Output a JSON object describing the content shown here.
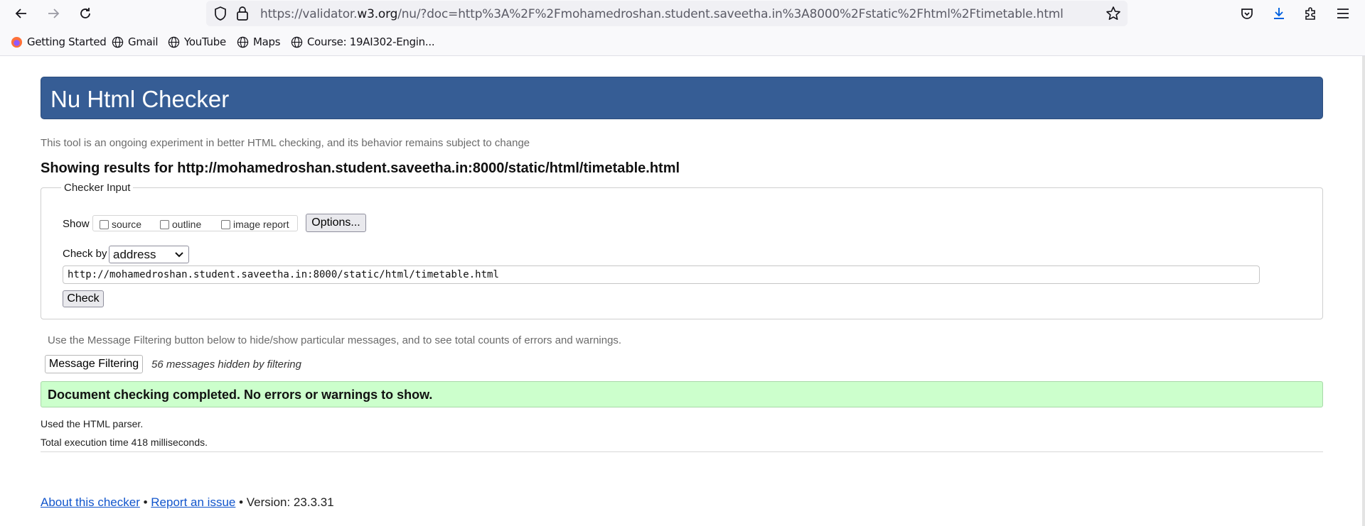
{
  "browser": {
    "url_prefix": "https://validator.",
    "url_host": "w3.org",
    "url_suffix": "/nu/?doc=http%3A%2F%2Fmohamedroshan.student.saveetha.in%3A8000%2Fstatic%2Fhtml%2Ftimetable.html",
    "icons": {
      "back": "arrow-left-icon",
      "forward": "arrow-right-icon",
      "reload": "reload-icon",
      "tracking": "shield-icon",
      "lock": "lock-icon",
      "bookmark_star": "star-icon",
      "pocket": "pocket-icon",
      "downloads": "download-icon",
      "extensions": "puzzle-icon",
      "menu": "hamburger-menu-icon"
    },
    "bookmarks": [
      {
        "label": "Getting Started",
        "icon": "firefox-icon"
      },
      {
        "label": "Gmail",
        "icon": "globe-icon"
      },
      {
        "label": "YouTube",
        "icon": "globe-icon"
      },
      {
        "label": "Maps",
        "icon": "globe-icon"
      },
      {
        "label": "Course: 19AI302-Engin...",
        "icon": "globe-icon"
      }
    ]
  },
  "page": {
    "title": "Nu Html Checker",
    "intro": "This tool is an ongoing experiment in better HTML checking, and its behavior remains subject to change",
    "results_title": "Showing results for http://mohamedroshan.student.saveetha.in:8000/static/html/timetable.html",
    "checker_input": {
      "legend": "Checker Input",
      "show_label": "Show",
      "show_options": [
        {
          "label": "source",
          "checked": false
        },
        {
          "label": "outline",
          "checked": false
        },
        {
          "label": "image report",
          "checked": false
        }
      ],
      "options_button": "Options...",
      "check_by_label": "Check by",
      "check_by_value": "address",
      "address_value": "http://mohamedroshan.student.saveetha.in:8000/static/html/timetable.html",
      "check_button": "Check"
    },
    "filter_note": "Use the Message Filtering button below to hide/show particular messages, and to see total counts of errors and warnings.",
    "filter_button": "Message Filtering",
    "hidden_count": "56 messages hidden by filtering",
    "success_message": "Document checking completed. No errors or warnings to show.",
    "parser_note": "Used the HTML parser.",
    "execution_time": "Total execution time 418 milliseconds.",
    "footer": {
      "about_link": "About this checker",
      "separator": "•",
      "report_link": "Report an issue",
      "version": "Version: 23.3.31"
    }
  },
  "colors": {
    "header_bg": "#365d95",
    "success_bg": "#ccffcc",
    "link": "#1155cc"
  }
}
